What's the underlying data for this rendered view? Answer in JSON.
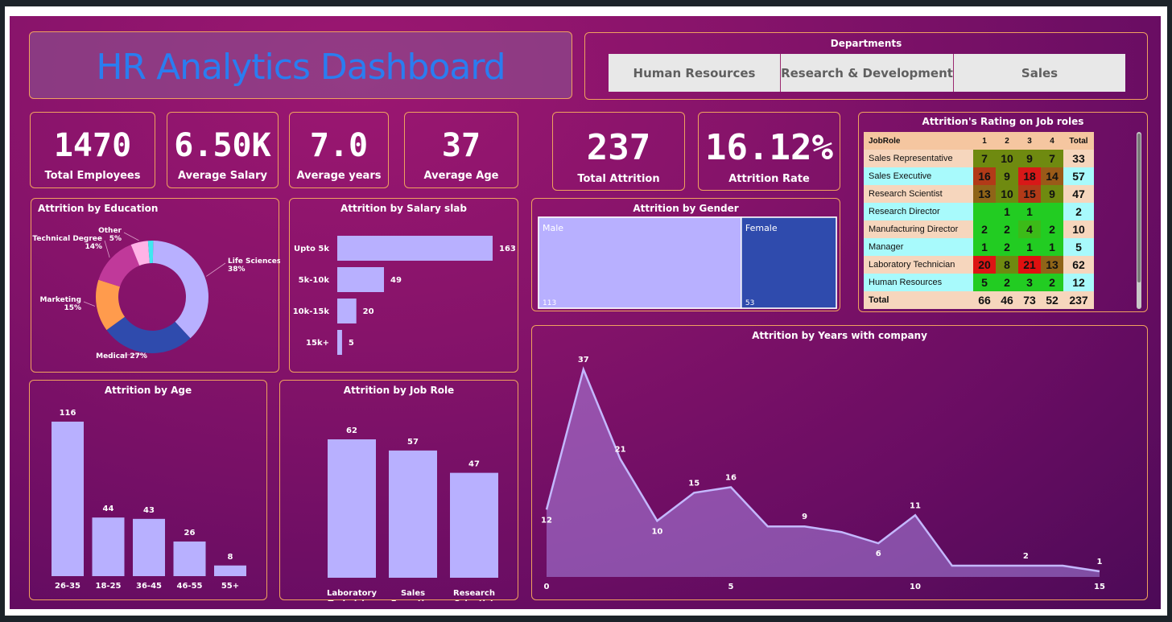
{
  "title": "HR Analytics Dashboard",
  "departments": {
    "title": "Departments",
    "items": [
      "Human Resources",
      "Research & Development",
      "Sales"
    ]
  },
  "kpis": {
    "total_employees": {
      "value": "1470",
      "label": "Total Employees"
    },
    "average_salary": {
      "value": "6.50K",
      "label": "Average Salary"
    },
    "average_years": {
      "value": "7.0",
      "label": "Average years"
    },
    "average_age": {
      "value": "37",
      "label": "Average Age"
    },
    "total_attrition": {
      "value": "237",
      "label": "Total Attrition"
    },
    "attrition_rate": {
      "value": "16.12%",
      "label": "Attrition Rate"
    }
  },
  "colors": {
    "bar": "#b8b0ff",
    "accent_border": "#f0a15f",
    "male": "#b8b0ff",
    "female": "#2f4bad",
    "title_blue": "#2a7df0"
  },
  "job_role_matrix": {
    "title": "Attrition's Rating on Job roles",
    "headers": [
      "JobRole",
      "1",
      "2",
      "3",
      "4",
      "Total"
    ],
    "rows": [
      {
        "role": "Sales Representative",
        "values": [
          "7",
          "10",
          "9",
          "7"
        ],
        "total": "33",
        "bg": "#f6d6bd",
        "cells": [
          "#6f8a10",
          "#6f8a10",
          "#6f8a10",
          "#6f8a10"
        ]
      },
      {
        "role": "Sales Executive",
        "values": [
          "16",
          "9",
          "18",
          "14"
        ],
        "total": "57",
        "bg": "#a8fafc",
        "cells": [
          "#b23a18",
          "#6f8a10",
          "#d81818",
          "#9a5a18"
        ]
      },
      {
        "role": "Research Scientist",
        "values": [
          "13",
          "10",
          "15",
          "9"
        ],
        "total": "47",
        "bg": "#f6d6bd",
        "cells": [
          "#8f6418",
          "#6f8a10",
          "#b23a18",
          "#6f8a10"
        ]
      },
      {
        "role": "Research Director",
        "values": [
          "",
          "1",
          "1",
          ""
        ],
        "total": "2",
        "bg": "#a8fafc",
        "cells": [
          "#22cc22",
          "#22cc22",
          "#22cc22",
          "#22cc22"
        ]
      },
      {
        "role": "Manufacturing Director",
        "values": [
          "2",
          "2",
          "4",
          "2"
        ],
        "total": "10",
        "bg": "#f6d6bd",
        "cells": [
          "#22cc22",
          "#22cc22",
          "#3cbb18",
          "#22cc22"
        ]
      },
      {
        "role": "Manager",
        "values": [
          "1",
          "2",
          "1",
          "1"
        ],
        "total": "5",
        "bg": "#a8fafc",
        "cells": [
          "#22cc22",
          "#22cc22",
          "#22cc22",
          "#22cc22"
        ]
      },
      {
        "role": "Laboratory Technician",
        "values": [
          "20",
          "8",
          "21",
          "13"
        ],
        "total": "62",
        "bg": "#f6d6bd",
        "cells": [
          "#dd1414",
          "#6f8a10",
          "#e01010",
          "#8f6418"
        ]
      },
      {
        "role": "Human Resources",
        "values": [
          "5",
          "2",
          "3",
          "2"
        ],
        "total": "12",
        "bg": "#a8fafc",
        "cells": [
          "#22cc22",
          "#22cc22",
          "#22cc22",
          "#22cc22"
        ]
      }
    ],
    "total_row": {
      "label": "Total",
      "values": [
        "66",
        "46",
        "73",
        "52"
      ],
      "total": "237"
    }
  },
  "chart_data": [
    {
      "id": "education",
      "type": "pie",
      "title": "Attrition by Education",
      "slices": [
        {
          "label": "Life Sciences",
          "pct": "38%",
          "value": 38,
          "color": "#b8b0ff"
        },
        {
          "label": "Medical",
          "pct": "27%",
          "value": 27,
          "color": "#2f4bad"
        },
        {
          "label": "Marketing",
          "pct": "15%",
          "value": 15,
          "color": "#ff9b4d"
        },
        {
          "label": "Technical Degree",
          "pct": "14%",
          "value": 14,
          "color": "#c0399a"
        },
        {
          "label": "Other",
          "pct": "5%",
          "value": 5,
          "color": "#ffb3e6"
        },
        {
          "label": "",
          "pct": "",
          "value": 1.5,
          "color": "#3ee8f0"
        }
      ]
    },
    {
      "id": "salary",
      "type": "bar",
      "orientation": "horizontal",
      "title": "Attrition by Salary slab",
      "categories": [
        "Upto 5k",
        "5k-10k",
        "10k-15k",
        "15k+"
      ],
      "values": [
        163,
        49,
        20,
        5
      ]
    },
    {
      "id": "gender",
      "type": "treemap",
      "title": "Attrition by Gender",
      "categories": [
        "Male",
        "Female"
      ],
      "values": [
        113,
        53
      ]
    },
    {
      "id": "age",
      "type": "bar",
      "title": "Attrition by Age",
      "categories": [
        "26-35",
        "18-25",
        "36-45",
        "46-55",
        "55+"
      ],
      "values": [
        116,
        44,
        43,
        26,
        8
      ]
    },
    {
      "id": "jobrole",
      "type": "bar",
      "title": "Attrition by Job Role",
      "categories": [
        "Laboratory Technician",
        "Sales Executive",
        "Research Scientist"
      ],
      "values": [
        62,
        57,
        47
      ]
    },
    {
      "id": "years",
      "type": "area",
      "title": "Attrition by Years with company",
      "x": [
        0,
        1,
        2,
        3,
        4,
        5,
        6,
        7,
        8,
        9,
        10,
        11,
        12,
        13,
        14,
        15
      ],
      "values": [
        12,
        37,
        21,
        10,
        15,
        16,
        9,
        9,
        8,
        6,
        11,
        2,
        2,
        2,
        2,
        1
      ],
      "labeled_points": [
        0,
        1,
        2,
        3,
        4,
        5,
        7,
        9,
        10,
        13,
        15
      ],
      "xticks": [
        0,
        5,
        10,
        15
      ],
      "ylim": [
        0,
        37
      ]
    }
  ]
}
